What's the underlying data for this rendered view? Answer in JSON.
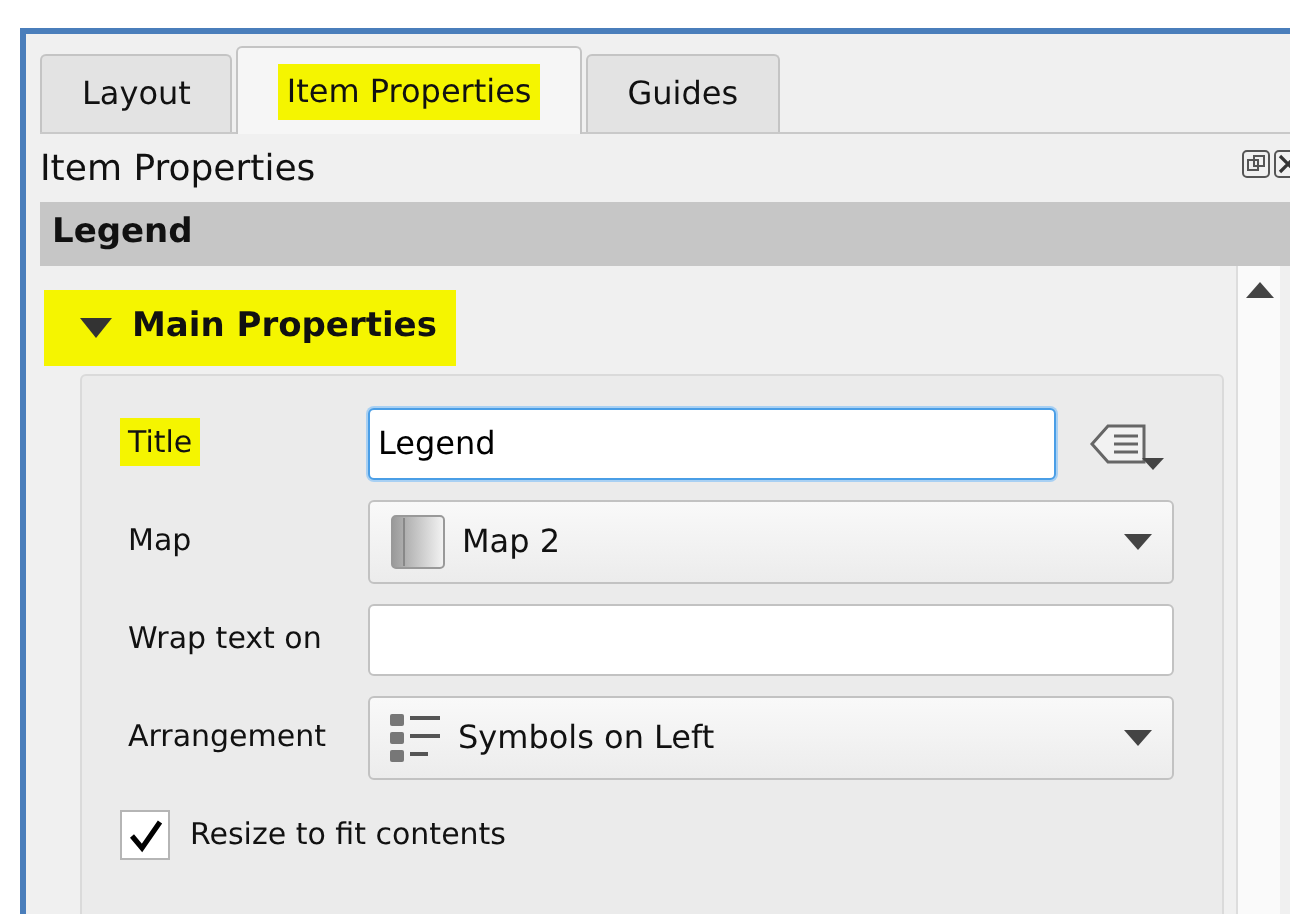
{
  "tabs": [
    {
      "label": "Layout",
      "selected": false,
      "highlighted": false
    },
    {
      "label": "Item Properties",
      "selected": true,
      "highlighted": true
    },
    {
      "label": "Guides",
      "selected": false,
      "highlighted": false
    }
  ],
  "panel": {
    "title": "Item Properties"
  },
  "item_bar": {
    "label": "Legend"
  },
  "section": {
    "label": "Main Properties",
    "expanded": true,
    "highlighted": true
  },
  "rows": [
    {
      "kind": "text",
      "label": "Title",
      "value": "Legend",
      "focused": true,
      "highlighted": true,
      "data_defined": true
    },
    {
      "kind": "combo",
      "label": "Map",
      "value": "Map 2",
      "highlighted": false
    },
    {
      "kind": "text",
      "label": "Wrap text on",
      "value": "",
      "focused": false,
      "highlighted": false,
      "data_defined": false
    },
    {
      "kind": "combo",
      "label": "Arrangement",
      "value": "Symbols on Left",
      "highlighted": false
    },
    {
      "kind": "checkbox",
      "label": "Resize to fit contents",
      "checked": true
    }
  ]
}
